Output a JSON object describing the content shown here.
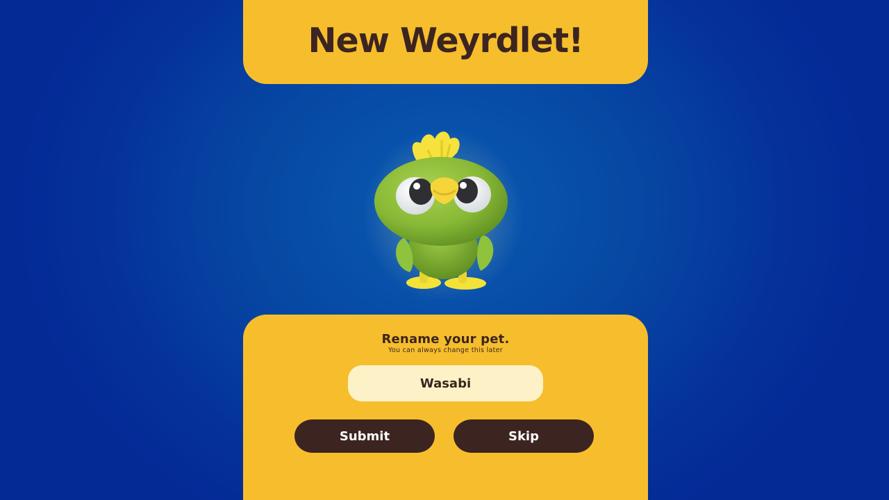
{
  "header": {
    "title": "New Weyrdlet!"
  },
  "pet": {
    "icon": "green-bird-pet-icon",
    "body_color": "#8dbf3a",
    "accent_color": "#f6e03a"
  },
  "rename": {
    "prompt": "Rename your pet.",
    "hint": "You can always change this later",
    "name_value": "Wasabi",
    "submit_label": "Submit",
    "skip_label": "Skip"
  },
  "colors": {
    "panel": "#f6be2c",
    "text_dark": "#3c2420",
    "input_bg": "#fdf2c7",
    "background": "#0648a3"
  }
}
